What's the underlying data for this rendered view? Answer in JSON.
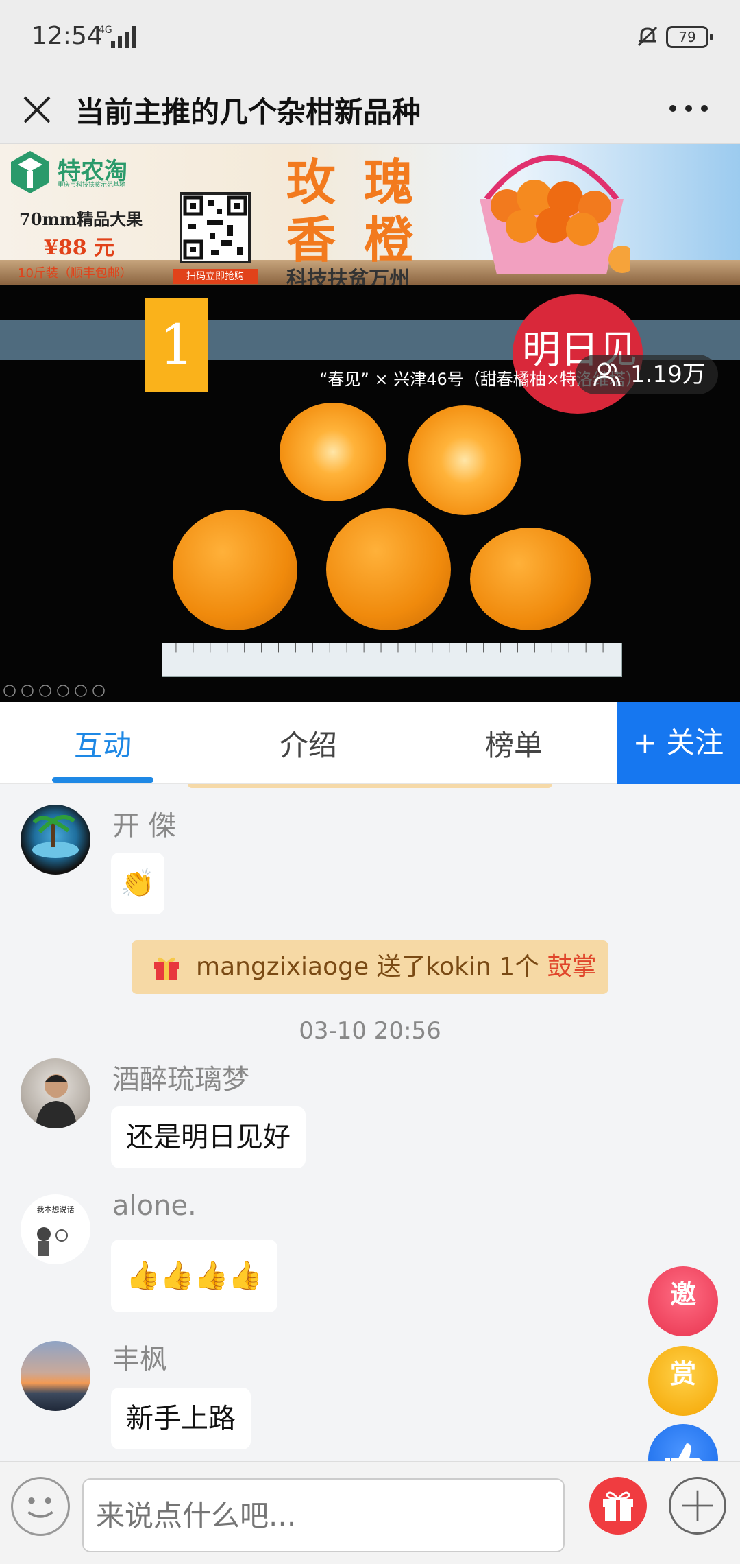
{
  "status_bar": {
    "time": "12:54",
    "network": "4G",
    "battery": "79"
  },
  "title_bar": {
    "title": "当前主推的几个杂柑新品种"
  },
  "banner": {
    "brand": "特农淘",
    "brand_sub": "重庆市科技扶贫示范基地",
    "promo_size": "70mm精品大果",
    "promo_price": "¥88 元",
    "promo_shipping": "10斤装（顺丰包邮）",
    "qr_label": "扫码立即抢购",
    "headline_line1": "玫 瑰",
    "headline_line2": "香 橙",
    "slogan": "科技扶贫万州"
  },
  "video": {
    "slide_number": "1",
    "tag": "明日见",
    "caption": "“春见” × 兴津46号（甜春橘柚×特洛维塔）",
    "viewers": "1.19万"
  },
  "tabs": {
    "items": [
      "互动",
      "介绍",
      "榜单"
    ],
    "follow": "+ 关注"
  },
  "chat": {
    "messages": [
      {
        "nick": "开 傑",
        "text": "👏"
      },
      {
        "nick": "酒醉琉璃梦",
        "text": "还是明日见好"
      },
      {
        "nick": "alone.",
        "text": "👍👍👍👍"
      },
      {
        "nick": "丰枫",
        "text": "新手上路"
      }
    ],
    "gift_notice": {
      "text": "mangzixiaoge 送了kokin 1个 ",
      "gift": "鼓掌"
    },
    "timestamp": "03-10 20:56",
    "alone_avatar_text": "我本想说话"
  },
  "float_buttons": {
    "invite": "邀",
    "reward": "赏"
  },
  "input_bar": {
    "placeholder": "来说点什么吧..."
  },
  "colors": {
    "accent": "#1e88e5",
    "follow": "#1677f0",
    "gift_bg": "#f6d9a5"
  }
}
